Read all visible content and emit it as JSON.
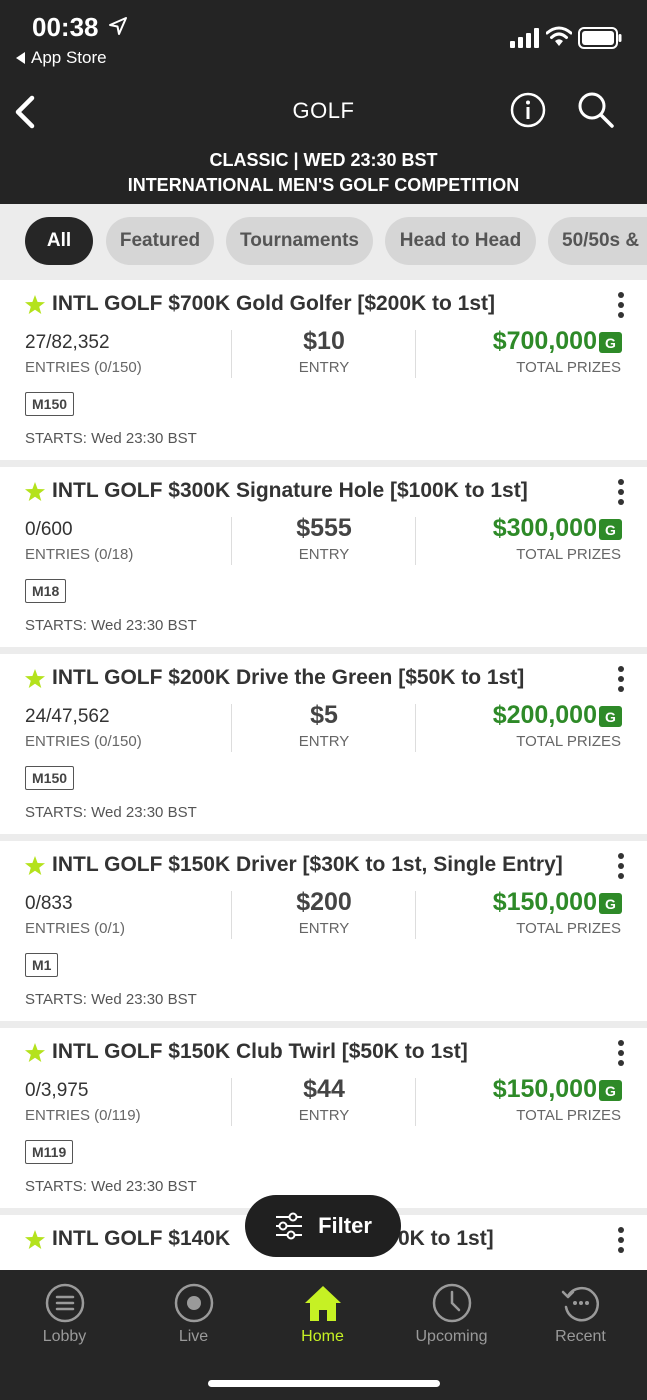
{
  "status_bar": {
    "time": "00:38",
    "back_app": "App Store"
  },
  "header": {
    "title": "GOLF",
    "subtitle_line1": "CLASSIC | WED 23:30 BST",
    "subtitle_line2": "INTERNATIONAL MEN'S GOLF COMPETITION"
  },
  "chips": [
    {
      "label": "All",
      "active": true
    },
    {
      "label": "Featured",
      "active": false
    },
    {
      "label": "Tournaments",
      "active": false
    },
    {
      "label": "Head to Head",
      "active": false
    },
    {
      "label": "50/50s &",
      "active": false
    }
  ],
  "contests": [
    {
      "title": "INTL GOLF $700K Gold Golfer [$200K to 1st]",
      "entries_count": "27/82,352",
      "entries_label": "ENTRIES (0/150)",
      "entry_fee": "$10",
      "entry_label": "ENTRY",
      "prize": "$700,000",
      "badge": "G",
      "prize_label": "TOTAL PRIZES",
      "tag": "M150",
      "starts": "STARTS: Wed 23:30 BST"
    },
    {
      "title": "INTL GOLF $300K Signature Hole [$100K to 1st]",
      "entries_count": "0/600",
      "entries_label": "ENTRIES (0/18)",
      "entry_fee": "$555",
      "entry_label": "ENTRY",
      "prize": "$300,000",
      "badge": "G",
      "prize_label": "TOTAL PRIZES",
      "tag": "M18",
      "starts": "STARTS: Wed 23:30 BST"
    },
    {
      "title": "INTL GOLF $200K Drive the Green [$50K to 1st]",
      "entries_count": "24/47,562",
      "entries_label": "ENTRIES (0/150)",
      "entry_fee": "$5",
      "entry_label": "ENTRY",
      "prize": "$200,000",
      "badge": "G",
      "prize_label": "TOTAL PRIZES",
      "tag": "M150",
      "starts": "STARTS: Wed 23:30 BST"
    },
    {
      "title": "INTL GOLF $150K Driver [$30K to 1st, Single Entry]",
      "entries_count": "0/833",
      "entries_label": "ENTRIES (0/1)",
      "entry_fee": "$200",
      "entry_label": "ENTRY",
      "prize": "$150,000",
      "badge": "G",
      "prize_label": "TOTAL PRIZES",
      "tag": "M1",
      "starts": "STARTS: Wed 23:30 BST"
    },
    {
      "title": "INTL GOLF $150K Club Twirl [$50K to 1st]",
      "entries_count": "0/3,975",
      "entries_label": "ENTRIES (0/119)",
      "entry_fee": "$44",
      "entry_label": "ENTRY",
      "prize": "$150,000",
      "badge": "G",
      "prize_label": "TOTAL PRIZES",
      "tag": "M119",
      "starts": "STARTS: Wed 23:30 BST"
    },
    {
      "title": "INTL GOLF $140K [$40K to 1st]",
      "entries_count": "",
      "entries_label": "",
      "entry_fee": "",
      "entry_label": "",
      "prize": "",
      "badge": "G",
      "prize_label": "",
      "tag": "",
      "starts": "",
      "partial_title_left": "INTL GOLF $140K",
      "partial_title_right": "0K to 1st]"
    }
  ],
  "filter": {
    "label": "Filter"
  },
  "tabbar": [
    {
      "label": "Lobby",
      "icon": "lobby-icon",
      "active": false
    },
    {
      "label": "Live",
      "icon": "live-icon",
      "active": false
    },
    {
      "label": "Home",
      "icon": "home-icon",
      "active": true
    },
    {
      "label": "Upcoming",
      "icon": "clock-icon",
      "active": false
    },
    {
      "label": "Recent",
      "icon": "history-icon",
      "active": false
    }
  ],
  "colors": {
    "header_bg": "#242424",
    "accent": "#c6f124",
    "prize_green": "#2e8a28",
    "star_yellow": "#b4e21c"
  }
}
